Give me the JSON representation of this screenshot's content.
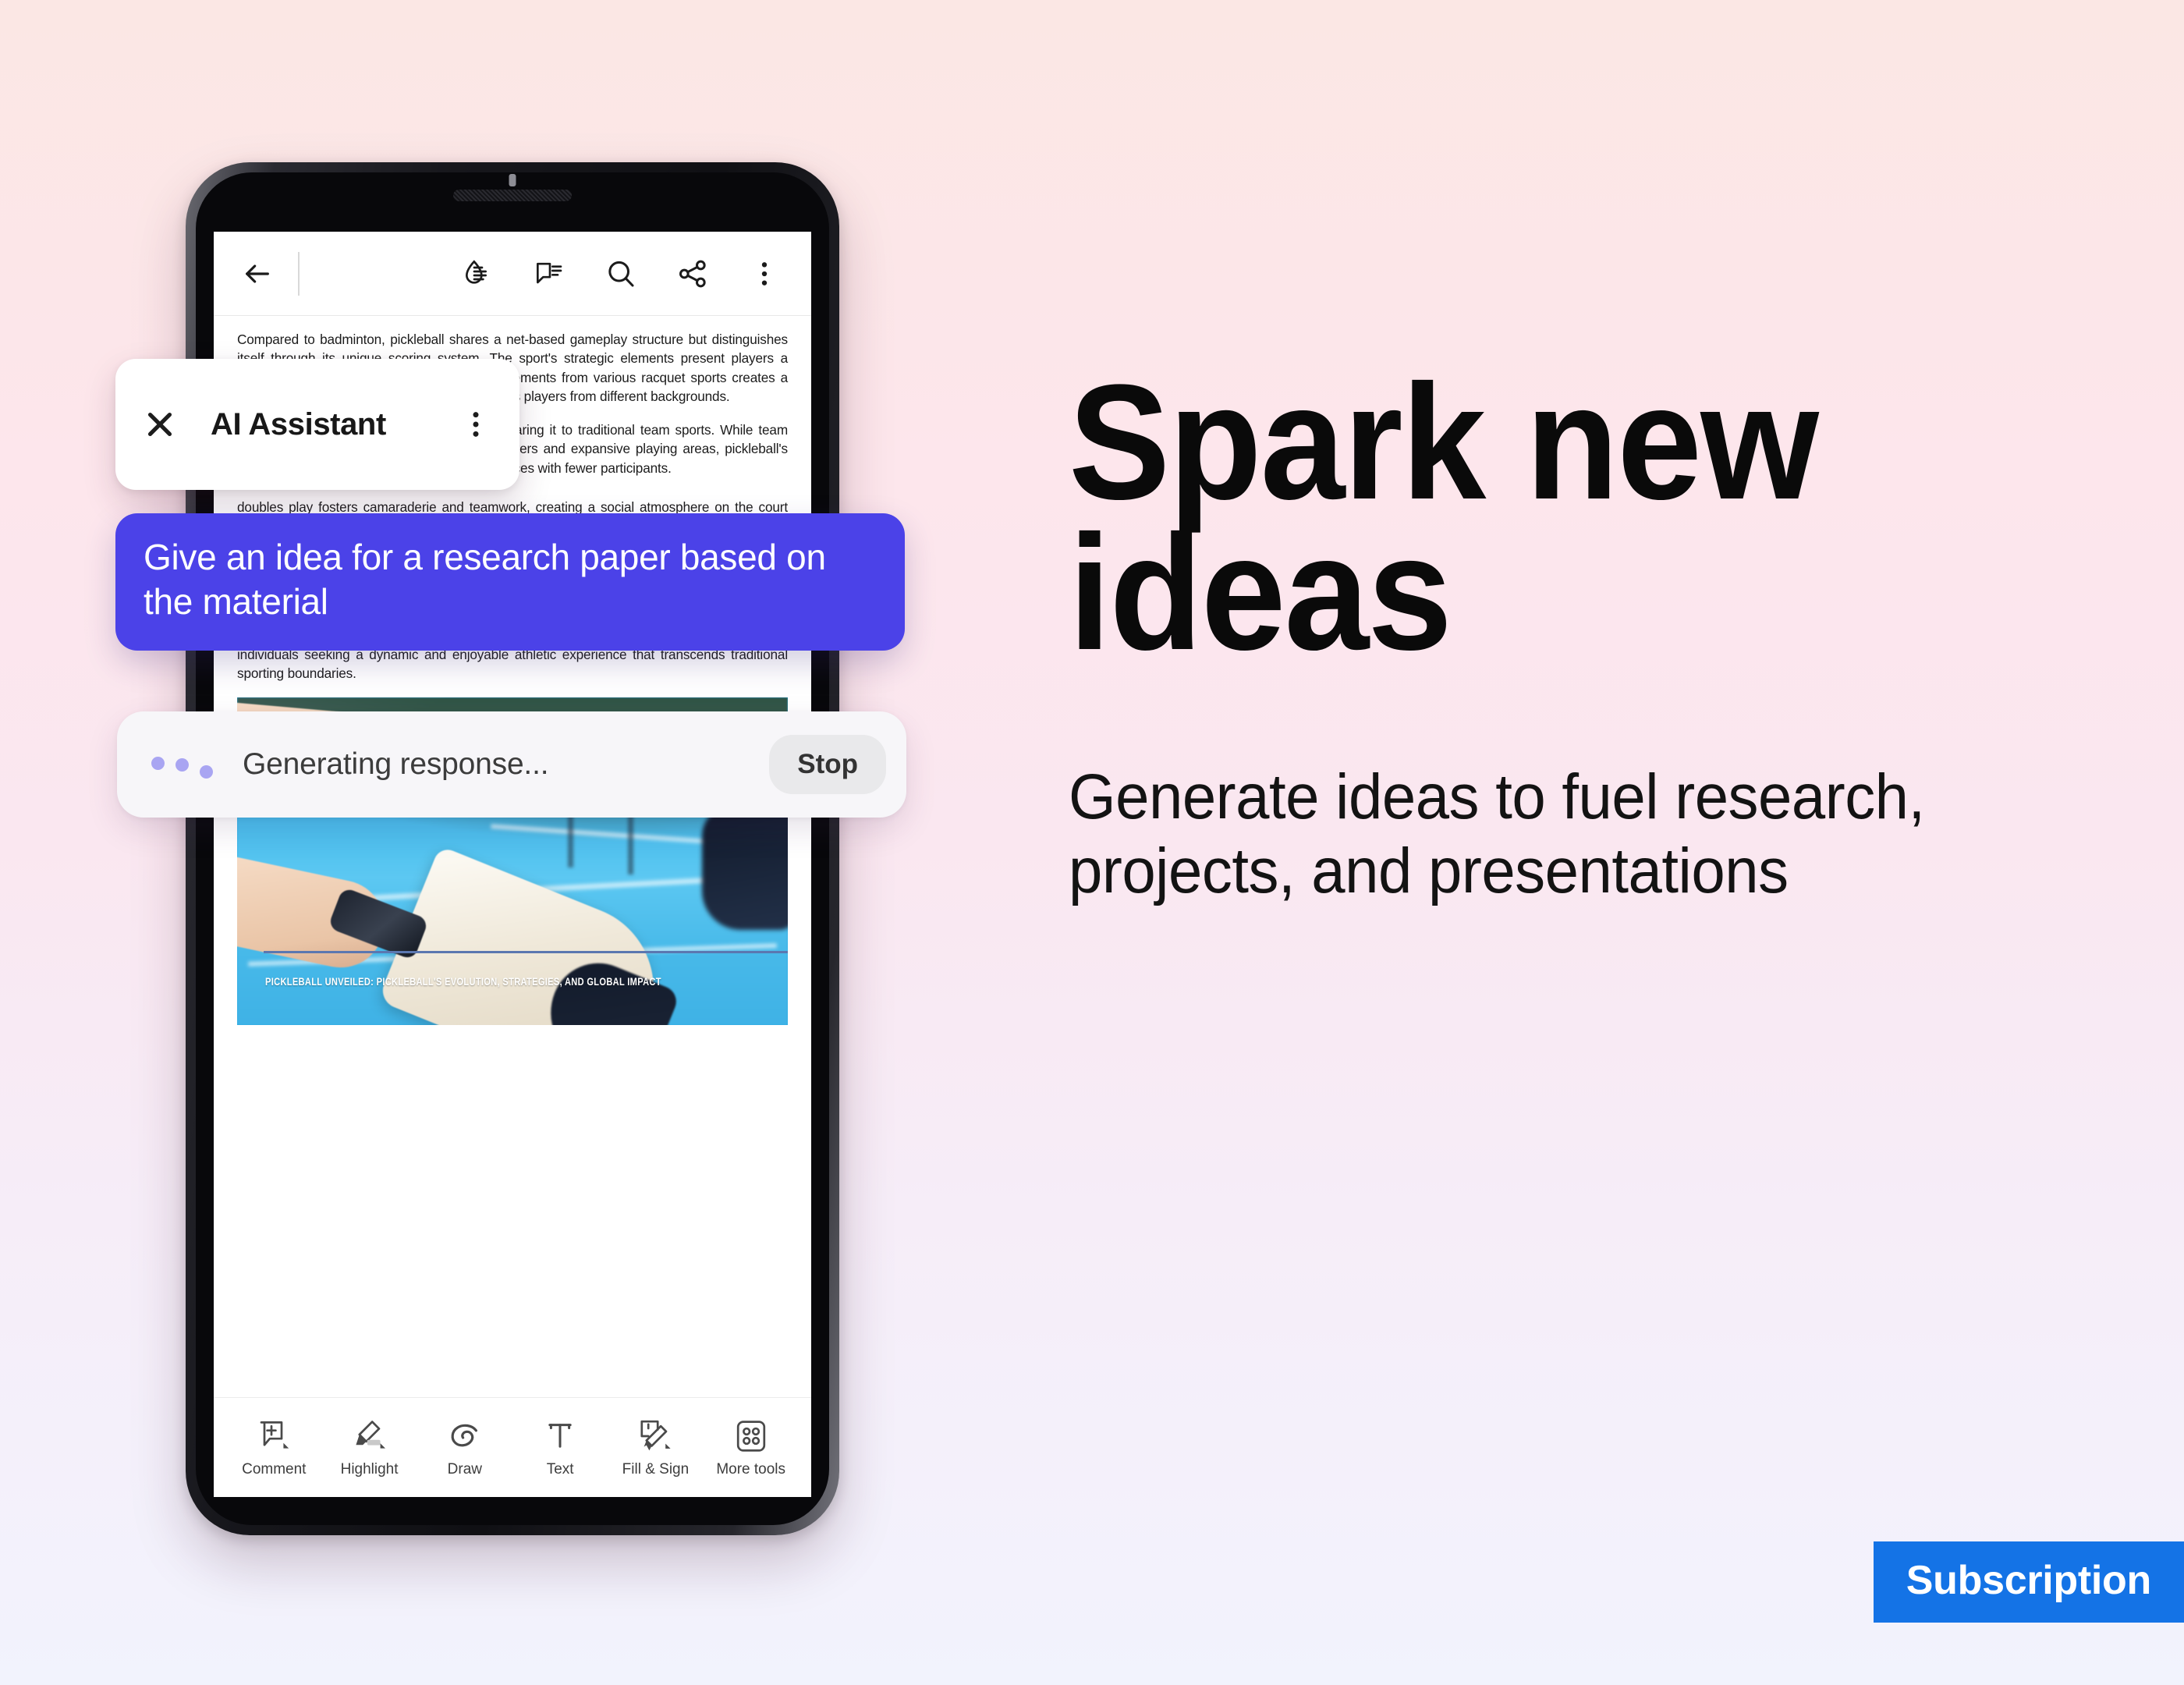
{
  "theme": {
    "background_gradient_top": "#FBE7E4",
    "background_gradient_bottom": "#F2F3FD",
    "prompt_bubble_color": "#4B42E8",
    "subscription_badge_color": "#1473E6",
    "dots_color": "#A9A5F2"
  },
  "phone": {
    "app_topbar": {
      "back_icon": "arrow-left-icon",
      "icons": [
        {
          "name": "liquid-mode-icon",
          "label": "Liquid Mode"
        },
        {
          "name": "comment-icon",
          "label": "Comments"
        },
        {
          "name": "search-icon",
          "label": "Search"
        },
        {
          "name": "share-icon",
          "label": "Share"
        },
        {
          "name": "kebab-menu-icon",
          "label": "More options"
        }
      ]
    },
    "document": {
      "paragraphs": [
        "Compared to badminton, pickleball shares a net-based gameplay structure but distinguishes itself through its unique scoring system. The sport's strategic elements present players a different set of challenges and the blend of elements from various racquet sports creates a fusion that offers a unique experience that draws players from different backgrounds.",
        "Pickleball's accessibility is evident when comparing it to traditional team sports. While team sports typically require a larger number of players and expansive playing areas, pickleball's adaptability allows it to be played in smaller spaces with fewer participants.",
        "doubles play fosters camaraderie and teamwork, creating a social atmosphere on the court that contributes to the overall enjoyment of the game. The communal aspect, combined with the sport's relatively straightforward rules, encourages players of all ages and skill levels to engage in friendly competition and social interaction.",
        "As the pickleball community continues to grow, the sport's distinctive features and inclusive nature position it as a standout option in the realm of recreational sports. Its blend of accessibility, adaptability, and social engagement provides a compelling alternative for individuals seeking a dynamic and enjoyable athletic experience that transcends traditional sporting boundaries."
      ],
      "photo_caption": "PICKLEBALL UNVEILED: PICKLEBALL'S EVOLUTION, STRATEGIES, AND GLOBAL IMPACT"
    },
    "tools": [
      {
        "icon": "add-comment-icon",
        "label": "Comment"
      },
      {
        "icon": "highlighter-icon",
        "label": "Highlight"
      },
      {
        "icon": "draw-icon",
        "label": "Draw"
      },
      {
        "icon": "text-icon",
        "label": "Text"
      },
      {
        "icon": "fill-and-sign-icon",
        "label": "Fill & Sign"
      },
      {
        "icon": "more-tools-icon",
        "label": "More tools"
      }
    ]
  },
  "ai_assistant": {
    "close_icon": "close-icon",
    "title": "AI Assistant",
    "kebab_icon": "kebab-menu-icon"
  },
  "prompt": {
    "text": "Give an idea for a research paper based on the material"
  },
  "generating": {
    "status_text": "Generating response...",
    "stop_label": "Stop"
  },
  "marketing": {
    "headline_line1": "Spark new",
    "headline_line2": "ideas",
    "subhead_line1": "Generate ideas to fuel research,",
    "subhead_line2": "projects, and presentations",
    "badge_label": "Subscription"
  }
}
